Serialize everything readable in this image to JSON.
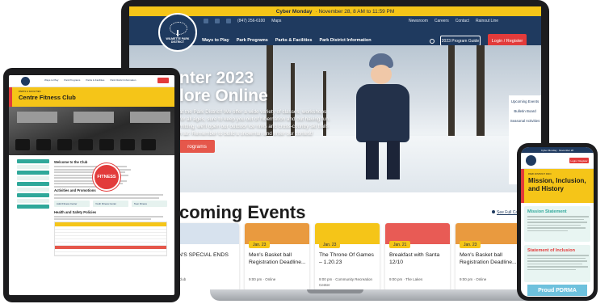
{
  "laptop": {
    "promo_label": "Cyber Monday",
    "promo_text": "· November 28, 8 AM to 11:59 PM",
    "phone": "(847) 256-6100",
    "maps": "Maps",
    "newsroom": "Newsroom",
    "careers": "Careers",
    "contact": "Contact",
    "rainout": "Rainout Line",
    "logo_text": "WILMETTE PARK DISTRICT",
    "nav": [
      "Ways to Play",
      "Park Programs",
      "Parks & Facilities",
      "Park District Information"
    ],
    "guide_button": "2023 Program Guide",
    "login_button": "Login / Register",
    "hero_title_line1": "nter 2023",
    "hero_title_line2": "lore Online",
    "hero_body": "at the Park District! We offer a wide variety of classes, workshops for all ages, sure to keep you out of hibernation and out having fun. mitting, we'll open our outdoor ice rinks and cross-country ski trails h air. Remember to build a snowman and enter our contest!",
    "hero_cta": "rograms",
    "quicklinks": [
      "Upcoming Events",
      "Bulletin Board",
      "Seasonal Activities"
    ],
    "events_title": "coming Events",
    "see_all": "See Full Calendar",
    "events": [
      {
        "date": "",
        "title": "N'S SPECIAL ENDS",
        "meta": "Club",
        "color": "#d7e2ee"
      },
      {
        "date": "Jan. 23",
        "title": "Men's Basket ball Registration Deadline...",
        "meta": "9:00 pm · Online",
        "color": "#e99a3f"
      },
      {
        "date": "Jan. 23",
        "title": "The Throne Of Games – 1.20.23",
        "meta": "9:00 pm · Community Recreation Center",
        "color": "#f5c518"
      },
      {
        "date": "Jan. 21",
        "title": "Breakfast with Santa 12/10",
        "meta": "9:00 pm · The Lakes",
        "color": "#e85b55"
      },
      {
        "date": "Jan. 23",
        "title": "Men's Basket ball Registration Deadline...",
        "meta": "9:00 pm · Online",
        "color": "#e99a3f"
      }
    ]
  },
  "tablet": {
    "nav": [
      "Ways to Play",
      "Park Programs",
      "Parks & Facilities",
      "Park District Information"
    ],
    "banner_sub": "PARKS & FACILITIES",
    "banner_title": "Centre Fitness Club",
    "badge": "FITNESS",
    "sections": [
      "Welcome to the Club",
      "Activities and Promotions",
      "Health and Safety Policies"
    ],
    "chips": [
      "Adult Fitness Center",
      "Youth Fitness Center",
      "Teen Fitness"
    ]
  },
  "phone": {
    "promo": "Cyber Monday · November 28",
    "login": "Login / Register",
    "banner_sub": "PARK DISTRICT INFO",
    "banner_title": "Mission, Inclusion, and History",
    "box1_title": "Mission Statement",
    "box2_title": "Statement of Inclusion",
    "footer": "Proud PDRMA"
  },
  "colors": {
    "navy": "#1f3a5f",
    "yellow": "#f5c518",
    "red": "#e23b3b",
    "teal": "#2fa89a"
  }
}
